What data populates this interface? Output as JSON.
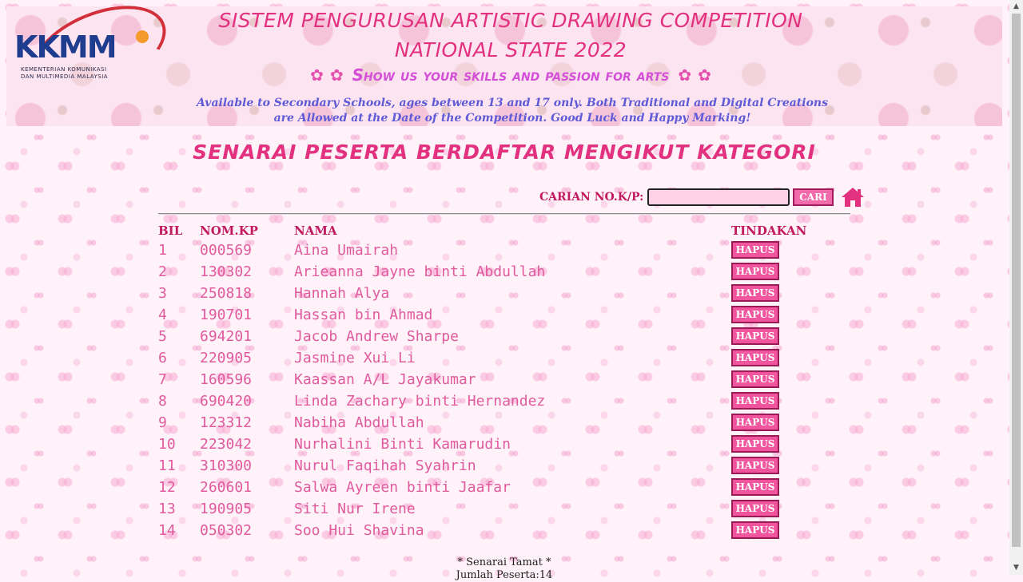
{
  "header": {
    "logo_text": "KKMM",
    "logo_sub_line1": "KEMENTERIAN KOMUNIKASI",
    "logo_sub_line2": "DAN MULTIMEDIA MALAYSIA",
    "title_line1": "SISTEM PENGURUSAN ARTISTIC DRAWING COMPETITION",
    "title_line2": "NATIONAL STATE 2022",
    "tagline": "Show us your skills and passion for arts",
    "description": "Available to Secondary Schools, ages between 13 and 17 only. Both Traditional and Digital Creations are Allowed at the Date of the Competition. Good Luck and Happy Marking!"
  },
  "page_heading": "SENARAI PESERTA BERDAFTAR MENGIKUT KATEGORI",
  "search": {
    "label": "CARIAN NO.K/P:",
    "value": "",
    "button_label": "CARI",
    "home_icon": "home-icon"
  },
  "table": {
    "headers": {
      "bil": "BIL",
      "nokp": "NOM.KP",
      "nama": "NAMA",
      "tindakan": "TINDAKAN"
    },
    "action_label": "HAPUS",
    "rows": [
      {
        "bil": "1",
        "nokp": "000569",
        "nama": "Aina Umairah"
      },
      {
        "bil": "2",
        "nokp": "130302",
        "nama": "Arieanna Jayne binti Abdullah"
      },
      {
        "bil": "3",
        "nokp": "250818",
        "nama": "Hannah Alya"
      },
      {
        "bil": "4",
        "nokp": "190701",
        "nama": "Hassan bin Ahmad"
      },
      {
        "bil": "5",
        "nokp": "694201",
        "nama": "Jacob Andrew Sharpe"
      },
      {
        "bil": "6",
        "nokp": "220905",
        "nama": "Jasmine Xui Li"
      },
      {
        "bil": "7",
        "nokp": "160596",
        "nama": "Kaassan A/L Jayakumar"
      },
      {
        "bil": "8",
        "nokp": "690420",
        "nama": "Linda Zachary binti Hernandez"
      },
      {
        "bil": "9",
        "nokp": "123312",
        "nama": "Nabiha Abdullah"
      },
      {
        "bil": "10",
        "nokp": "223042",
        "nama": "Nurhalini Binti Kamarudin"
      },
      {
        "bil": "11",
        "nokp": "310300",
        "nama": "Nurul Faqihah Syahrin"
      },
      {
        "bil": "12",
        "nokp": "260601",
        "nama": "Salwa Ayreen binti Jaafar"
      },
      {
        "bil": "13",
        "nokp": "190905",
        "nama": "Siti Nur Irene"
      },
      {
        "bil": "14",
        "nokp": "050302",
        "nama": "Soo Hui Shavina"
      }
    ]
  },
  "footer": {
    "end_text": "* Senarai Tamat *",
    "total_text": "Jumlah Peserta:14"
  },
  "colors": {
    "accent": "#e2327f",
    "button": "#f0559d",
    "description": "#5f5ad6"
  }
}
